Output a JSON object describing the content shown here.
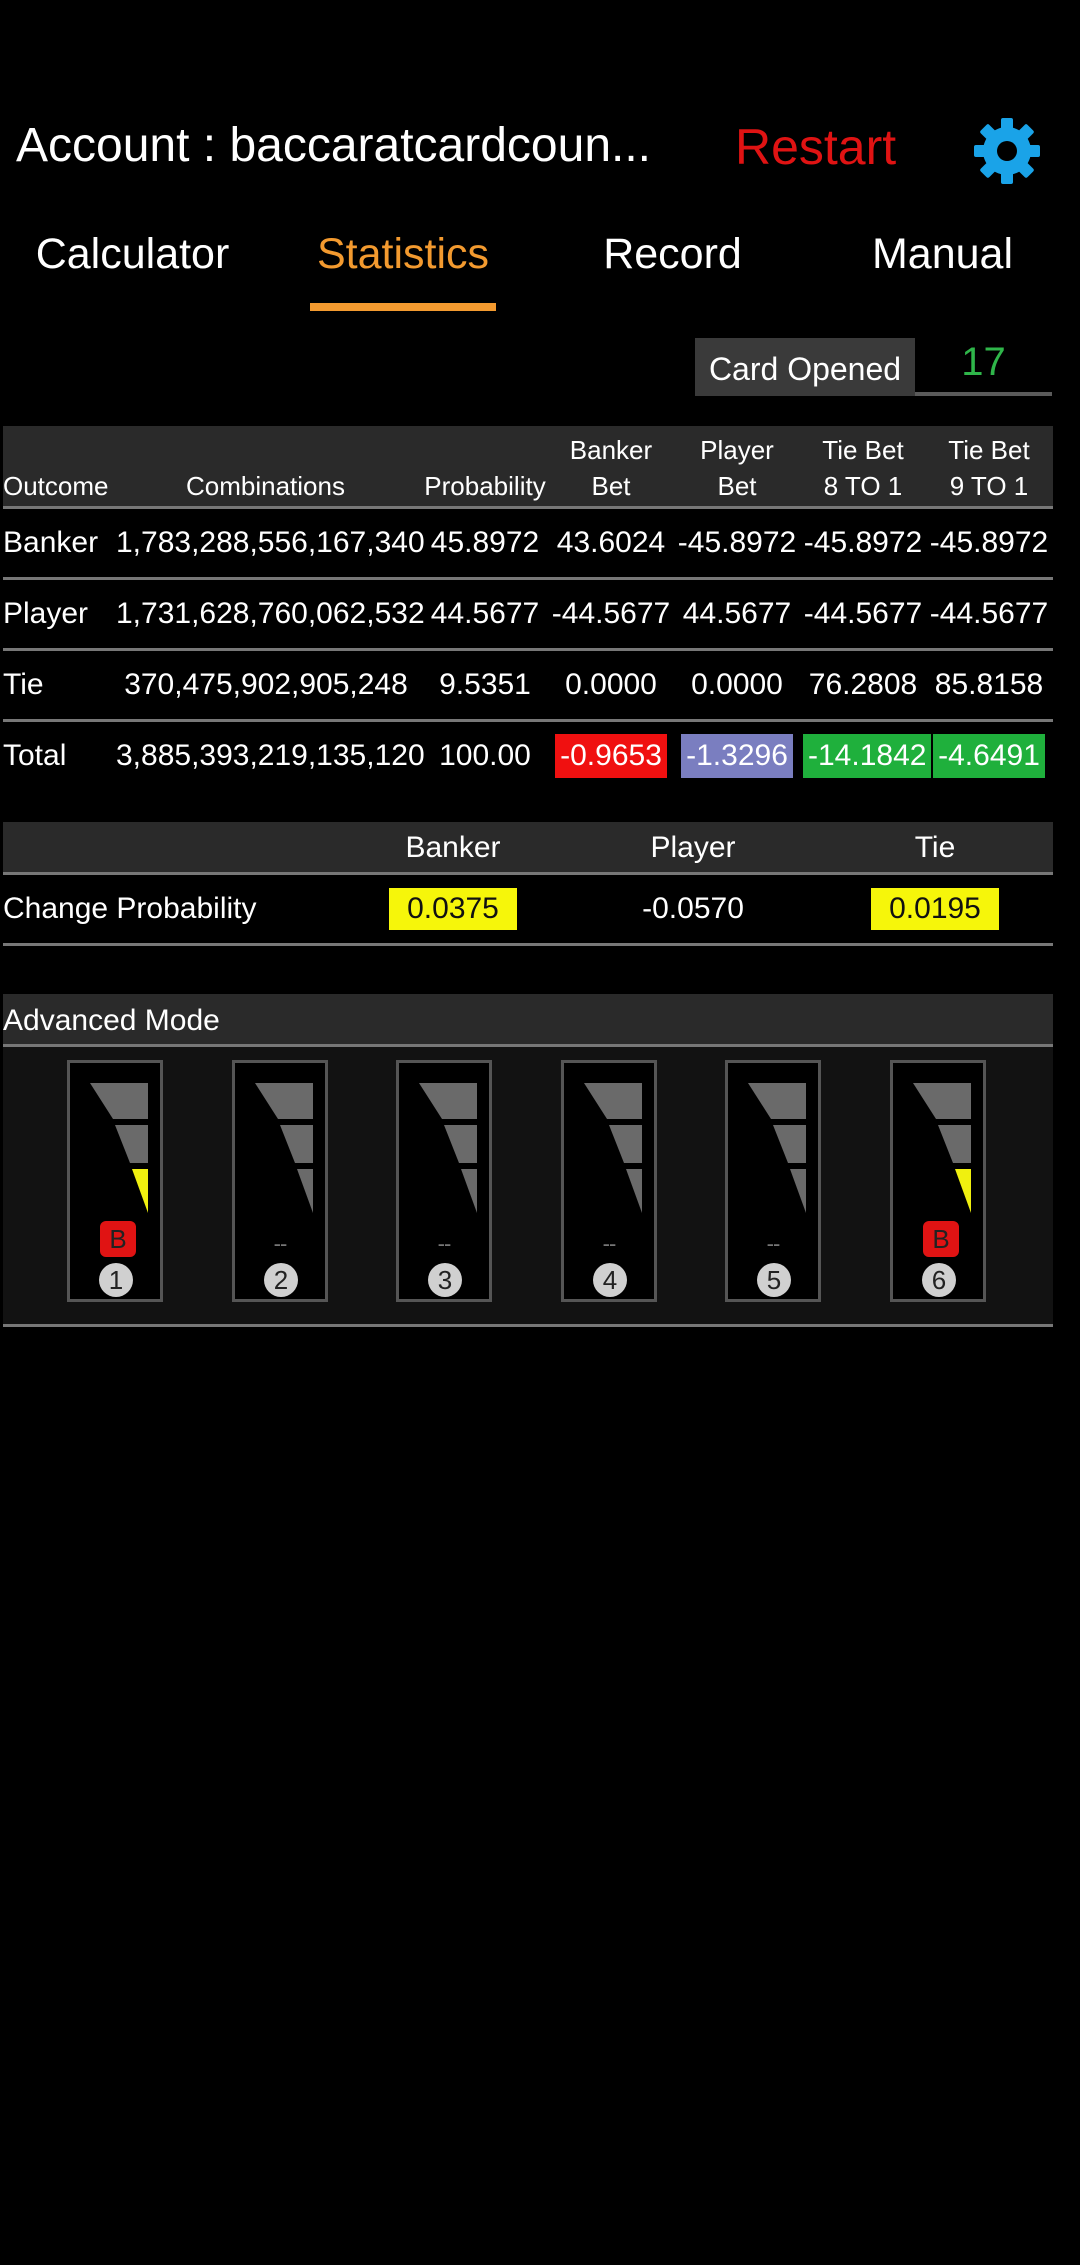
{
  "header": {
    "account_text": "Account : baccaratcardcoun...",
    "restart_label": "Restart",
    "settings_icon": "gear-icon",
    "settings_color": "#1aa3e8",
    "restart_color": "#e01313"
  },
  "tabs": [
    {
      "label": "Calculator",
      "active": false
    },
    {
      "label": "Statistics",
      "active": true
    },
    {
      "label": "Record",
      "active": false
    },
    {
      "label": "Manual",
      "active": false
    }
  ],
  "accent_color": "#f39a2f",
  "card_opened": {
    "label": "Card Opened",
    "value": "17"
  },
  "stats_table": {
    "headers": {
      "outcome": "Outcome",
      "combinations": "Combinations",
      "probability": "Probability",
      "banker_bet_1": "Banker",
      "banker_bet_2": "Bet",
      "player_bet_1": "Player",
      "player_bet_2": "Bet",
      "tie8_1": "Tie Bet",
      "tie8_2": "8 TO 1",
      "tie9_1": "Tie Bet",
      "tie9_2": "9 TO 1"
    },
    "rows": [
      {
        "outcome": "Banker",
        "combinations": "1,783,288,556,167,340",
        "probability": "45.8972",
        "banker_bet": "43.6024",
        "player_bet": "-45.8972",
        "tie8": "-45.8972",
        "tie9": "-45.8972"
      },
      {
        "outcome": "Player",
        "combinations": "1,731,628,760,062,532",
        "probability": "44.5677",
        "banker_bet": "-44.5677",
        "player_bet": "44.5677",
        "tie8": "-44.5677",
        "tie9": "-44.5677"
      },
      {
        "outcome": "Tie",
        "combinations": "370,475,902,905,248",
        "probability": "9.5351",
        "banker_bet": "0.0000",
        "player_bet": "0.0000",
        "tie8": "76.2808",
        "tie9": "85.8158"
      },
      {
        "outcome": "Total",
        "combinations": "3,885,393,219,135,120",
        "probability": "100.00",
        "banker_bet": "-0.9653",
        "player_bet": "-1.3296",
        "tie8": "-14.1842",
        "tie9": "-4.6491"
      }
    ],
    "total_colors": {
      "banker_bet": "#f01010",
      "player_bet": "#7a7ec0",
      "tie8": "#1fb03c",
      "tie9": "#1fb03c"
    }
  },
  "change_probability": {
    "headers": {
      "banker": "Banker",
      "player": "Player",
      "tie": "Tie"
    },
    "label": "Change Probability",
    "banker": "0.0375",
    "player": "-0.0570",
    "tie": "0.0195",
    "highlight_color": "#f6f60a"
  },
  "advanced_mode": {
    "title": "Advanced Mode",
    "slots": [
      {
        "number": "1",
        "badge": "B",
        "yellow_bar": true
      },
      {
        "number": "2",
        "badge": "--",
        "yellow_bar": false
      },
      {
        "number": "3",
        "badge": "--",
        "yellow_bar": false
      },
      {
        "number": "4",
        "badge": "--",
        "yellow_bar": false
      },
      {
        "number": "5",
        "badge": "--",
        "yellow_bar": false
      },
      {
        "number": "6",
        "badge": "B",
        "yellow_bar": true
      }
    ]
  }
}
